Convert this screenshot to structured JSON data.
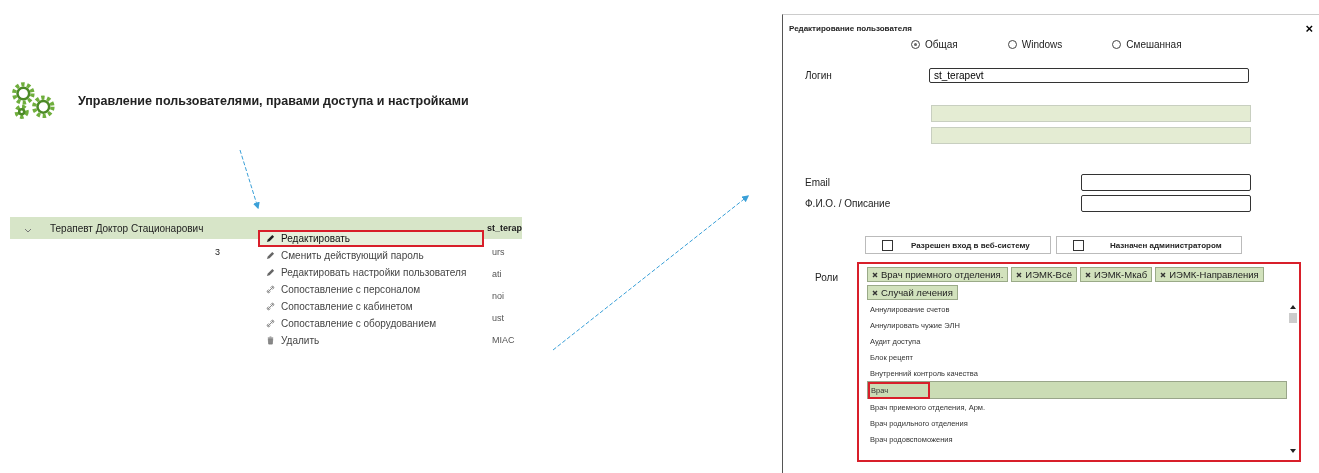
{
  "header": {
    "title": "Управление пользователями, правами доступа и настройками"
  },
  "user_row": {
    "expanded": true,
    "name": "Терапевт Доктор Стационарович",
    "column_2": "3"
  },
  "context_menu": [
    {
      "label": "Редактировать",
      "kind": "edit",
      "highlighted": true
    },
    {
      "label": "Сменить действующий пароль",
      "kind": "edit",
      "highlighted": false
    },
    {
      "label": "Редактировать настройки пользователя",
      "kind": "edit",
      "highlighted": false
    },
    {
      "label": "Сопоставление с персоналом",
      "kind": "mapping",
      "highlighted": false
    },
    {
      "label": "Сопоставление с кабинетом",
      "kind": "mapping",
      "highlighted": false
    },
    {
      "label": "Сопоставление с оборудованием",
      "kind": "mapping",
      "highlighted": false
    },
    {
      "label": "Удалить",
      "kind": "delete",
      "highlighted": false
    }
  ],
  "column_3": [
    "st_terap",
    "urs",
    "ati",
    "noi",
    "ust",
    "MIAC"
  ],
  "dialog": {
    "title": "Редактирование пользователя",
    "close": "×",
    "auth_modes": [
      {
        "label": "Общая",
        "selected": true
      },
      {
        "label": "Windows",
        "selected": false
      },
      {
        "label": "Смешанная",
        "selected": false
      }
    ],
    "login_label": "Логин",
    "login_value": "st_terapevt",
    "email_label": "Email",
    "name_label": "Ф.И.О. / Описание",
    "checkboxes": [
      {
        "label": "Разрешен вход в веб-систему",
        "checked": false
      },
      {
        "label": "Назначен администратором",
        "checked": false
      }
    ],
    "roles_label": "Роли",
    "roles_highlighted": true,
    "role_tags": [
      {
        "label": "Врач приемного отделения."
      },
      {
        "label": "ИЭМК-Всё"
      },
      {
        "label": "ИЭМК-Мкаб"
      },
      {
        "label": "ИЭМК-Направления"
      },
      {
        "label": "Случай лечения"
      }
    ],
    "role_options": [
      {
        "label": "Аннулирование счетов",
        "selected": false,
        "highlighted": false
      },
      {
        "label": "Аннулировать чужие ЭЛН",
        "selected": false,
        "highlighted": false
      },
      {
        "label": "Аудит доступа",
        "selected": false,
        "highlighted": false
      },
      {
        "label": "Блок рецепт",
        "selected": false,
        "highlighted": false
      },
      {
        "label": "Внутренний контроль качества",
        "selected": false,
        "highlighted": false
      },
      {
        "label": "Врач",
        "selected": true,
        "highlighted": true
      },
      {
        "label": "Врач приемного отделения, Арм.",
        "selected": false,
        "highlighted": false
      },
      {
        "label": "Врач родильного отделения",
        "selected": false,
        "highlighted": false
      },
      {
        "label": "Врач родовспоможения",
        "selected": false,
        "highlighted": false
      }
    ]
  }
}
